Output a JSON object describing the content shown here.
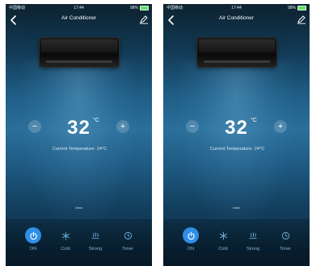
{
  "status_bar": {
    "carrier": "中国移动",
    "time": "17:44",
    "battery": "98%"
  },
  "nav": {
    "title": "Air Conditioner"
  },
  "thermostat": {
    "set_temperature": "32",
    "unit": "°C",
    "minus_label": "−",
    "plus_label": "+",
    "current_label": "Current Temperature:",
    "current_value": "24°C"
  },
  "controls": [
    {
      "label": "ON",
      "icon": "power-icon"
    },
    {
      "label": "Cold",
      "icon": "snowflake-icon"
    },
    {
      "label": "Strong",
      "icon": "wind-strong-icon"
    },
    {
      "label": "Timer",
      "icon": "clock-icon"
    }
  ],
  "colors": {
    "accent": "#2f8fe8",
    "label": "#7fb6dc"
  }
}
